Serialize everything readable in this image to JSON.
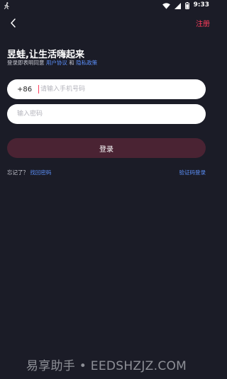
{
  "status_bar": {
    "time": "9:33"
  },
  "nav": {
    "register_label": "注册"
  },
  "login": {
    "title": "昱蛙,让生活嗨起来",
    "agreement_prefix": "登录即表明同意",
    "user_agreement": "用户协议",
    "and_text": "和",
    "privacy_policy": "隐私政策",
    "country_code": "+86",
    "phone_placeholder": "请输入手机号码",
    "phone_value": "",
    "password_placeholder": "输入密码",
    "password_value": "",
    "login_button": "登录",
    "forgot_prefix": "忘记了？",
    "retrieve_password": "找回密码",
    "sms_login": "验证码登录"
  },
  "watermark": "易享助手 • EEDSHZJZ.COM",
  "colors": {
    "background": "#1b1c27",
    "accent": "#ff3d5c",
    "link": "#5b8ff9",
    "login_button": "#4a2333"
  }
}
